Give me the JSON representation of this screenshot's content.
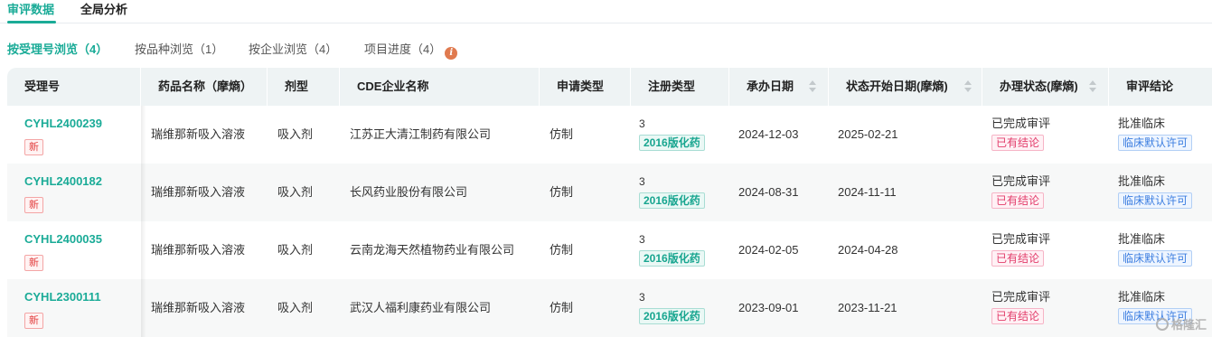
{
  "top_tabs": [
    {
      "label": "审评数据",
      "active": true
    },
    {
      "label": "全局分析",
      "active": false
    }
  ],
  "sub_tabs": [
    {
      "label": "按受理号浏览（4）",
      "active": true
    },
    {
      "label": "按品种浏览（1）",
      "active": false
    },
    {
      "label": "按企业浏览（4）",
      "active": false
    },
    {
      "label": "项目进度（4）",
      "active": false,
      "info_icon": "i"
    }
  ],
  "columns": [
    "受理号",
    "药品名称（摩熵）",
    "剂型",
    "CDE企业名称",
    "申请类型",
    "注册类型",
    "承办日期",
    "状态开始日期(摩熵)",
    "办理状态(摩熵)",
    "审评结论"
  ],
  "rows": [
    {
      "id": "CYHL2400239",
      "badge": "新",
      "drug": "瑞维那新吸入溶液",
      "form": "吸入剂",
      "company": "江苏正大清江制药有限公司",
      "app_type": "仿制",
      "reg_num": "3",
      "reg_tag": "2016版化药",
      "accept_date": "2024-12-03",
      "status_date": "2025-02-21",
      "status": "已完成审评",
      "status_tag": "已有结论",
      "conclusion": "批准临床",
      "conclusion_tag": "临床默认许可"
    },
    {
      "id": "CYHL2400182",
      "badge": "新",
      "drug": "瑞维那新吸入溶液",
      "form": "吸入剂",
      "company": "长风药业股份有限公司",
      "app_type": "仿制",
      "reg_num": "3",
      "reg_tag": "2016版化药",
      "accept_date": "2024-08-31",
      "status_date": "2024-11-11",
      "status": "已完成审评",
      "status_tag": "已有结论",
      "conclusion": "批准临床",
      "conclusion_tag": "临床默认许可"
    },
    {
      "id": "CYHL2400035",
      "badge": "新",
      "drug": "瑞维那新吸入溶液",
      "form": "吸入剂",
      "company": "云南龙海天然植物药业有限公司",
      "app_type": "仿制",
      "reg_num": "3",
      "reg_tag": "2016版化药",
      "accept_date": "2024-02-05",
      "status_date": "2024-04-28",
      "status": "已完成审评",
      "status_tag": "已有结论",
      "conclusion": "批准临床",
      "conclusion_tag": "临床默认许可"
    },
    {
      "id": "CYHL2300111",
      "badge": "新",
      "drug": "瑞维那新吸入溶液",
      "form": "吸入剂",
      "company": "武汉人福利康药业有限公司",
      "app_type": "仿制",
      "reg_num": "3",
      "reg_tag": "2016版化药",
      "accept_date": "2023-09-01",
      "status_date": "2023-11-21",
      "status": "已完成审评",
      "status_tag": "已有结论",
      "conclusion": "批准临床",
      "conclusion_tag": "临床默认许可"
    }
  ],
  "watermark": "格隆汇",
  "colors": {
    "accent": "#1aab97",
    "badge_red": "#e23c3c",
    "tag_pink": "#e23c6a",
    "tag_blue": "#3b7de0",
    "info_orange": "#e07a4f"
  }
}
